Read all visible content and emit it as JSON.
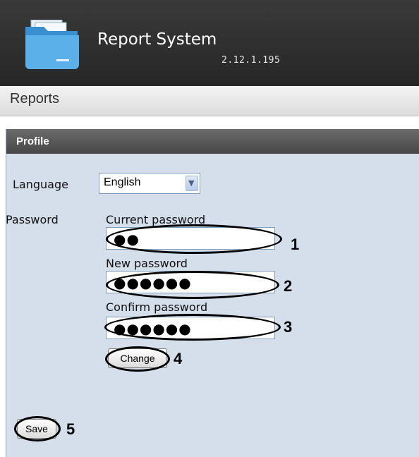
{
  "app": {
    "title": "Report System",
    "version": "2.12.1.195"
  },
  "nav": {
    "reports_label": "Reports"
  },
  "profile": {
    "title": "Profile",
    "language": {
      "label": "Language",
      "selected": "English"
    },
    "password": {
      "label": "Password",
      "current_label": "Current password",
      "current_value": "●●",
      "new_label": "New password",
      "new_value": "●●●●●●",
      "confirm_label": "Confirm password",
      "confirm_value": "●●●●●●",
      "change_button": "Change"
    },
    "save_button": "Save"
  },
  "annotations": [
    "1",
    "2",
    "3",
    "4",
    "5"
  ],
  "colors": {
    "header": "#2f2f2f",
    "panel": "#d5dfeb",
    "panel_header": "#555555"
  }
}
